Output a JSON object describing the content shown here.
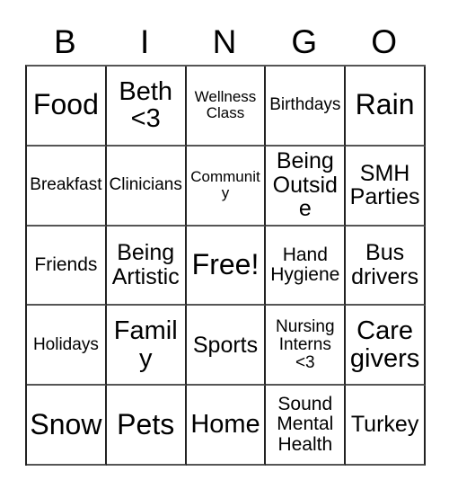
{
  "card": {
    "title": "BINGO Card",
    "header_letters": [
      "B",
      "I",
      "N",
      "G",
      "O"
    ],
    "columns": 5,
    "rows": 5,
    "border_color": "#222222",
    "background_color": "#ffffff",
    "text_color": "#000000",
    "cells": [
      [
        {
          "label": "Food",
          "size": "fs-xl"
        },
        {
          "label": "Beth\n<3",
          "size": "fs-lg"
        },
        {
          "label": "Wellness\nClass",
          "size": "fs-xxs"
        },
        {
          "label": "Birthdays",
          "size": "fs-xs"
        },
        {
          "label": "Rain",
          "size": "fs-xl"
        }
      ],
      [
        {
          "label": "Breakfast",
          "size": "fs-xs"
        },
        {
          "label": "Clinicians",
          "size": "fs-xs"
        },
        {
          "label": "Community",
          "size": "fs-xxs"
        },
        {
          "label": "Being\nOutside",
          "size": "fs-md"
        },
        {
          "label": "SMH\nParties",
          "size": "fs-md"
        }
      ],
      [
        {
          "label": "Friends",
          "size": "fs-sm"
        },
        {
          "label": "Being\nArtistic",
          "size": "fs-md"
        },
        {
          "label": "Free!",
          "size": "fs-xl"
        },
        {
          "label": "Hand\nHygiene",
          "size": "fs-sm"
        },
        {
          "label": "Bus\ndrivers",
          "size": "fs-md"
        }
      ],
      [
        {
          "label": "Holidays",
          "size": "fs-xs"
        },
        {
          "label": "Family",
          "size": "fs-lg"
        },
        {
          "label": "Sports",
          "size": "fs-md"
        },
        {
          "label": "Nursing\nInterns\n<3",
          "size": "fs-xs"
        },
        {
          "label": "Care\ngivers",
          "size": "fs-lg"
        }
      ],
      [
        {
          "label": "Snow",
          "size": "fs-xl"
        },
        {
          "label": "Pets",
          "size": "fs-xl"
        },
        {
          "label": "Home",
          "size": "fs-lg"
        },
        {
          "label": "Sound\nMental\nHealth",
          "size": "fs-sm"
        },
        {
          "label": "Turkey",
          "size": "fs-md"
        }
      ]
    ]
  }
}
